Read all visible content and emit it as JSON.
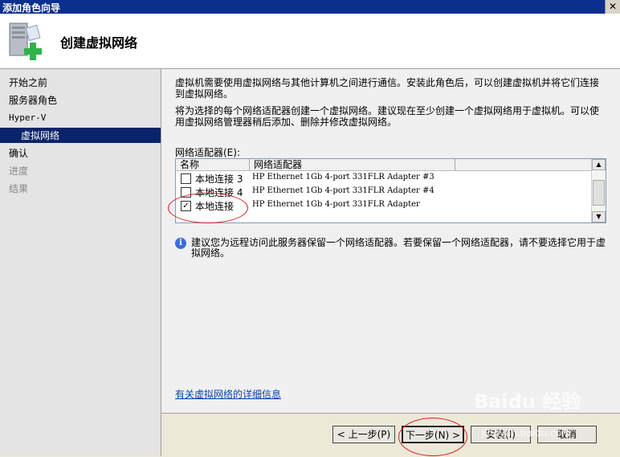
{
  "window": {
    "title": "添加角色向导",
    "close_glyph": "✕"
  },
  "header": {
    "title": "创建虚拟网络",
    "icon": "server-add-icon"
  },
  "nav": {
    "items": [
      {
        "label": "开始之前",
        "state": "normal"
      },
      {
        "label": "服务器角色",
        "state": "normal"
      },
      {
        "label": "Hyper-V",
        "state": "normal"
      },
      {
        "label": "虚拟网络",
        "state": "active"
      },
      {
        "label": "确认",
        "state": "normal"
      },
      {
        "label": "进度",
        "state": "disabled"
      },
      {
        "label": "结果",
        "state": "disabled"
      }
    ]
  },
  "content": {
    "para1": "虚拟机需要使用虚拟网络与其他计算机之间进行通信。安装此角色后，可以创建虚拟机并将它们连接到虚拟网络。",
    "para2": "将为选择的每个网络适配器创建一个虚拟网络。建议现在至少创建一个虚拟网络用于虚拟机。可以使用虚拟网络管理器稍后添加、删除并修改虚拟网络。",
    "adapters_label": "网络适配器(E):",
    "columns": {
      "name": "名称",
      "adapter": "网络适配器"
    },
    "adapters": [
      {
        "name": "本地连接 3",
        "adapter": "HP Ethernet 1Gb 4-port 331FLR Adapter #3",
        "checked": false
      },
      {
        "name": "本地连接 4",
        "adapter": "HP Ethernet 1Gb 4-port 331FLR Adapter #4",
        "checked": false
      },
      {
        "name": "本地连接",
        "adapter": "HP Ethernet 1Gb 4-port 331FLR Adapter",
        "checked": true
      }
    ],
    "info_text": "建议您为远程访问此服务器保留一个网络适配器。若要保留一个网络适配器，请不要选择它用于虚拟网络。",
    "details_link": "有关虚拟网络的详细信息"
  },
  "buttons": {
    "prev": "< 上一步(P)",
    "next": "下一步(N) >",
    "install": "安装(I)",
    "cancel": "取消"
  },
  "watermark": {
    "logo": "Baidu 经验",
    "url": "jingyan.baidu.com"
  },
  "colors": {
    "title_bar": "#0b2f8f",
    "nav_active": "#0a246a",
    "annotation": "#d42020",
    "link": "#0645ad"
  }
}
